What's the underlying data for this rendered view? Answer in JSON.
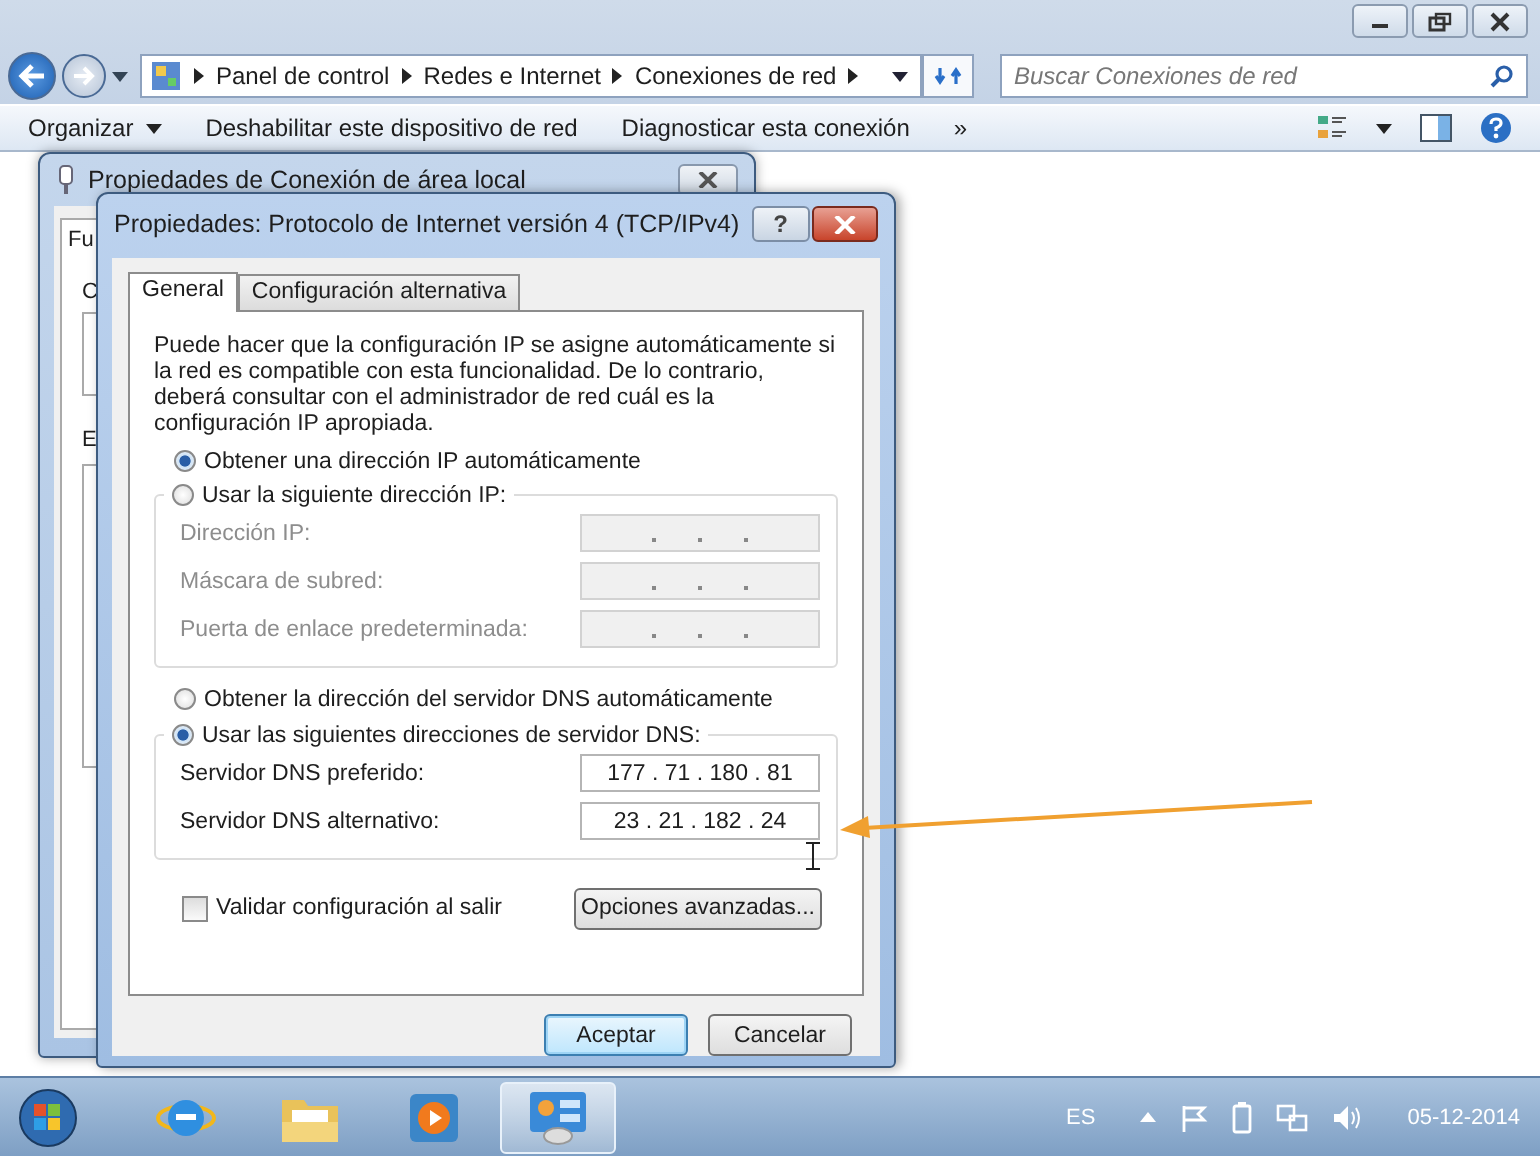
{
  "explorer": {
    "breadcrumb": [
      "Panel de control",
      "Redes e Internet",
      "Conexiones de red"
    ],
    "search": {
      "placeholder": "Buscar Conexiones de red"
    },
    "toolbar": [
      {
        "label": "Organizar",
        "dropdown": true
      },
      {
        "label": "Deshabilitar este dispositivo de red",
        "dropdown": false
      },
      {
        "label": "Diagnosticar esta conexión",
        "dropdown": false
      },
      {
        "label": "»",
        "dropdown": false
      }
    ]
  },
  "back_dialog": {
    "title": "Propiedades de Conexión de área local",
    "tab": "Fu",
    "labels": [
      "C",
      "E"
    ]
  },
  "dialog": {
    "title": "Propiedades: Protocolo de Internet versión 4 (TCP/IPv4)",
    "help": "?",
    "tabs": [
      {
        "label": "General",
        "selected": true
      },
      {
        "label": "Configuración alternativa",
        "selected": false
      }
    ],
    "description": "Puede hacer que la configuración IP se asigne automáticamente si la red es compatible con esta funcionalidad. De lo contrario, deberá consultar con el administrador de red cuál es la configuración IP apropiada.",
    "ip_options": [
      {
        "label": "Obtener una dirección IP automáticamente",
        "selected": true
      },
      {
        "label": "Usar la siguiente dirección IP:",
        "selected": false
      }
    ],
    "ip_fields": [
      {
        "label": "Dirección IP:",
        "disabled": true
      },
      {
        "label": "Máscara de subred:",
        "disabled": true
      },
      {
        "label": "Puerta de enlace predeterminada:",
        "disabled": true
      }
    ],
    "dns_options": [
      {
        "label": "Obtener la dirección del servidor DNS automáticamente",
        "selected": false
      },
      {
        "label": "Usar las siguientes direcciones de servidor DNS:",
        "selected": true
      }
    ],
    "dns_fields": [
      {
        "label": "Servidor DNS preferido:",
        "value": "177 . 71 . 180 . 81",
        "disabled": false
      },
      {
        "label": "Servidor DNS alternativo:",
        "value": "23 . 21 . 182 . 24",
        "disabled": false
      }
    ],
    "validate": {
      "label": "Validar configuración al salir",
      "checked": false
    },
    "advanced": "Opciones avanzadas...",
    "buttons": [
      {
        "label": "Aceptar",
        "default": true
      },
      {
        "label": "Cancelar",
        "default": false
      }
    ]
  },
  "taskbar": {
    "apps": [
      {
        "kind": "browser",
        "selected": false
      },
      {
        "kind": "folder",
        "selected": false
      },
      {
        "kind": "media",
        "selected": false
      },
      {
        "kind": "control",
        "selected": true
      }
    ],
    "language": "ES",
    "clock": "05-12-2014"
  }
}
